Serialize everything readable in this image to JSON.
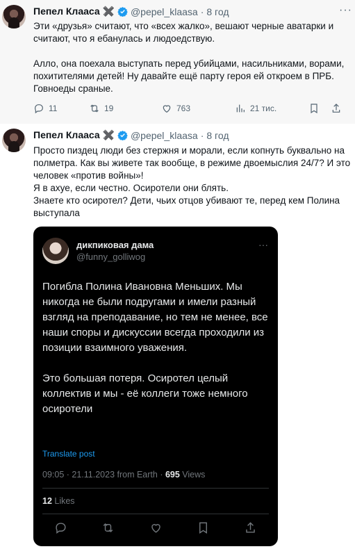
{
  "tweets": [
    {
      "author": "Пепел Клааса ✖️",
      "handle": "@pepel_klaasa",
      "dot": "·",
      "time": "8 год",
      "paragraphs": [
        "Эти «друзья» считают, что «всех жалко», вешают черные аватарки и считают, что я ебанулась и людоедствую.",
        "Алло, она поехала выступать перед убийцами, насильниками, ворами, похитителями детей! Ну давайте ещё парту героя ей откроем в ПРБ. Говноеды сраные."
      ],
      "actions": {
        "replies": "11",
        "retweets": "19",
        "likes": "763",
        "views": "21 тис."
      }
    },
    {
      "author": "Пепел Клааса ✖️",
      "handle": "@pepel_klaasa",
      "dot": "·",
      "time": "8 год",
      "lines": [
        "Просто пиздец люди без стержня и морали, если копнуть буквально на полметра. Как вы живете так вообще, в режиме двоемыслия 24/7? И это человек «против войны»!",
        "Я в ахуе, если честно. Осиротели они блять.",
        "Знаете кто осиротел? Дети, чьих отцов убивают те, перед кем Полина выступала"
      ],
      "embedded": {
        "name": "дикпиковая дама",
        "handle": "@funny_golliwog",
        "paragraphs": [
          "Погибла Полина Ивановна Меньших. Мы никогда не были подругами и имели разный взгляд на преподавание, но тем не менее, все наши споры и дискуссии всегда проходили из позиции взаимного уважения.",
          "Это большая потеря. Осиротел целый коллектив и мы - её коллеги тоже немного осиротели"
        ],
        "translate": "Translate post",
        "meta_time": "09:05 · 21.11.2023 from Earth · ",
        "views_count": "695",
        "views_label": " Views",
        "likes_count": "12",
        "likes_label": " Likes"
      }
    }
  ],
  "colors": {
    "verified": "#1d9bf0",
    "link": "#1d9bf0",
    "muted": "#536471"
  }
}
